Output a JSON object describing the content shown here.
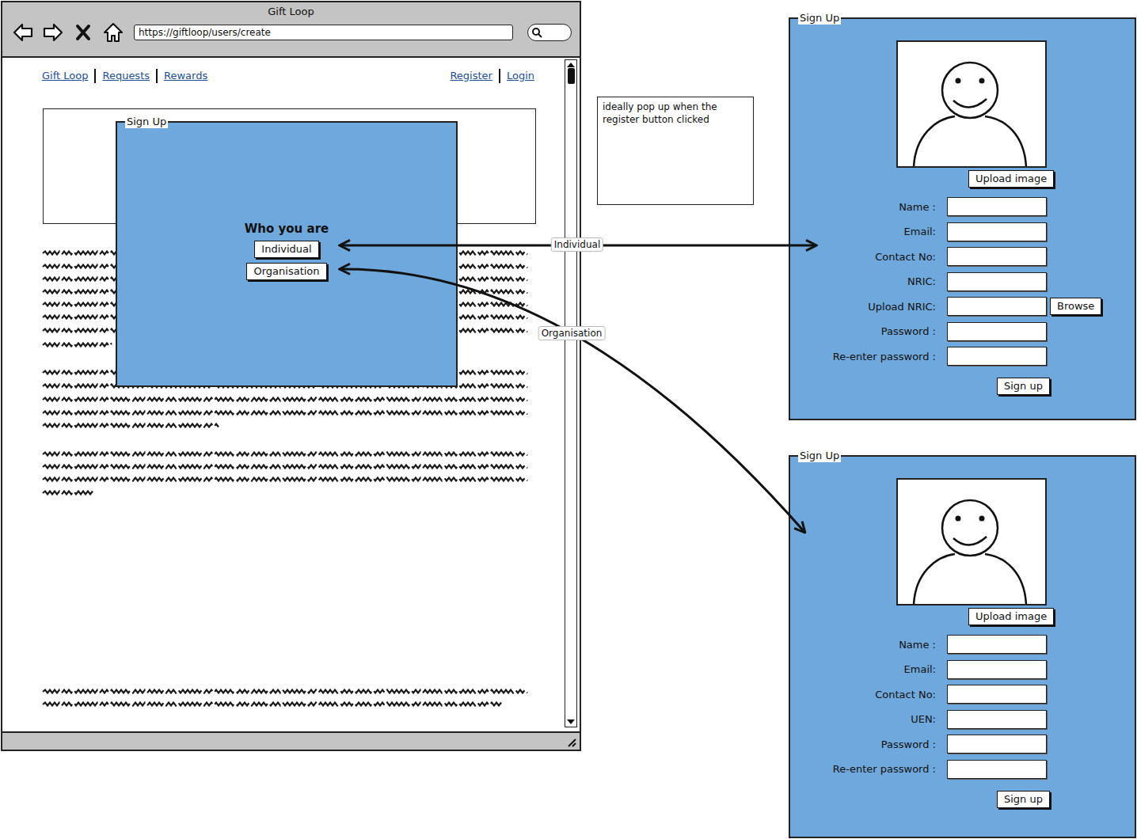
{
  "browser": {
    "title": "Gift Loop",
    "url": "https://giftloop/users/create",
    "nav_left": [
      "Gift Loop",
      "Requests",
      "Rewards"
    ],
    "nav_right": [
      "Register",
      "Login"
    ]
  },
  "popup": {
    "title": "Sign Up",
    "heading": "Who you are",
    "buttons": [
      "Individual",
      "Organisation"
    ]
  },
  "note": "ideally pop up when the register button clicked",
  "arrows": [
    {
      "label": "Individual"
    },
    {
      "label": "Organisation"
    }
  ],
  "forms": [
    {
      "title": "Sign Up",
      "upload_button": "Upload image",
      "fields": [
        {
          "label": "Name :",
          "kind": "text"
        },
        {
          "label": "Email:",
          "kind": "text"
        },
        {
          "label": "Contact No:",
          "kind": "text"
        },
        {
          "label": "NRIC:",
          "kind": "text"
        },
        {
          "label": "Upload NRIC:",
          "kind": "file",
          "button": "Browse"
        },
        {
          "label": "Password :",
          "kind": "text"
        },
        {
          "label": "Re-enter password :",
          "kind": "text"
        }
      ],
      "submit": "Sign up"
    },
    {
      "title": "Sign Up",
      "upload_button": "Upload image",
      "fields": [
        {
          "label": "Name :",
          "kind": "text"
        },
        {
          "label": "Email:",
          "kind": "text"
        },
        {
          "label": "Contact No:",
          "kind": "text"
        },
        {
          "label": "UEN:",
          "kind": "text"
        },
        {
          "label": "Password :",
          "kind": "text"
        },
        {
          "label": "Re-enter password :",
          "kind": "text"
        }
      ],
      "submit": "Sign up"
    }
  ]
}
